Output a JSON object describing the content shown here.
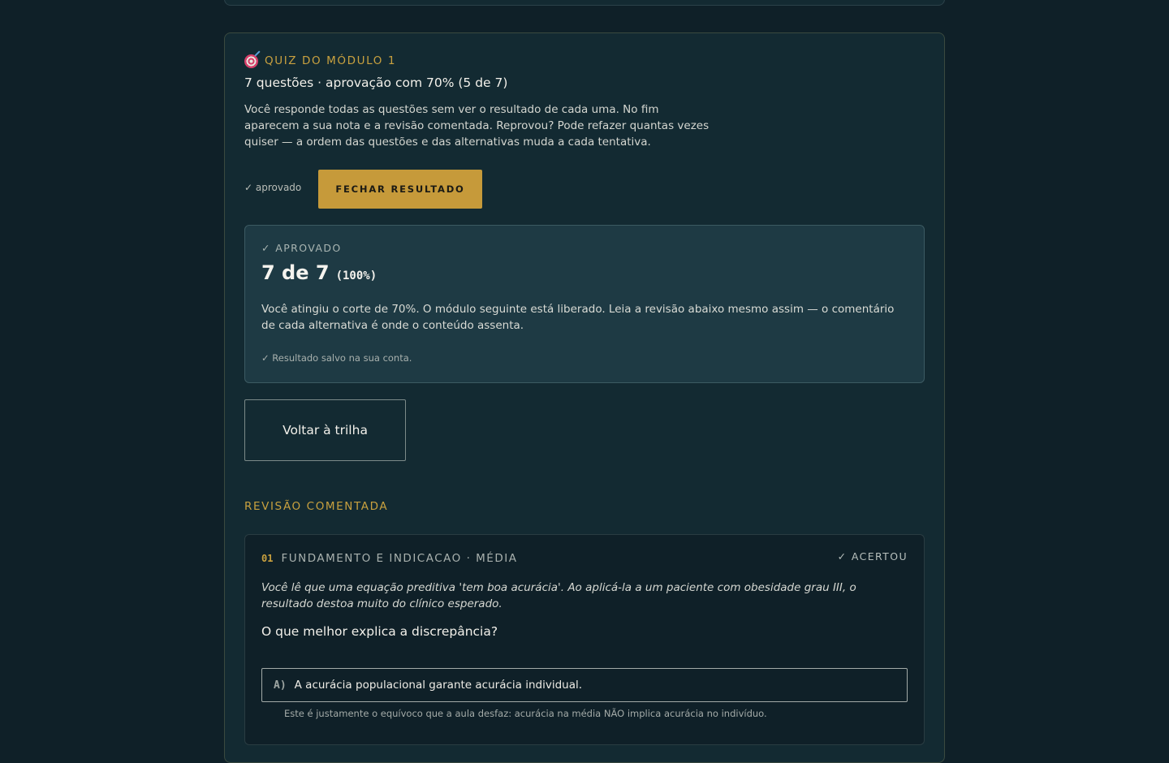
{
  "quiz": {
    "eyebrow": "QUIZ DO MÓDULO 1",
    "subtitle": "7 questões · aprovação com 70% (5 de 7)",
    "intro": "Você responde todas as questões sem ver o resultado de cada uma. No fim aparecem a sua nota e a revisão comentada. Reprovou? Pode refazer quantas vezes quiser — a ordem das questões e das alternativas muda a cada tentativa.",
    "approved_inline": "✓ aprovado",
    "close_label": "FECHAR RESULTADO"
  },
  "result": {
    "status": "✓ APROVADO",
    "score": "7 de 7",
    "percent": "(100%)",
    "text": "Você atingiu o corte de 70%. O módulo seguinte está liberado. Leia a revisão abaixo mesmo assim — o comentário de cada alternativa é onde o conteúdo assenta.",
    "saved_note": "✓ Resultado salvo na sua conta."
  },
  "back_label": "Voltar à trilha",
  "review": {
    "title": "REVISÃO COMENTADA",
    "questions": [
      {
        "number": "01",
        "topic": "FUNDAMENTO E INDICACAO · MÉDIA",
        "status": "✓ ACERTOU",
        "scenario": "Você lê que uma equação preditiva 'tem boa acurácia'. Ao aplicá-la a um paciente com obesidade grau III, o resultado destoa muito do clínico esperado.",
        "prompt": "O que melhor explica a discrepância?",
        "options": [
          {
            "letter": "A)",
            "text": "A acurácia populacional garante acurácia individual.",
            "comment": "Este é justamente o equívoco que a aula desfaz: acurácia na média NÃO implica acurácia no indivíduo."
          }
        ]
      }
    ]
  },
  "colors": {
    "background": "#0f2028",
    "accent": "#c69a3a",
    "panel": "#1e3a44"
  },
  "icons": {
    "eyebrow": "target-icon"
  }
}
